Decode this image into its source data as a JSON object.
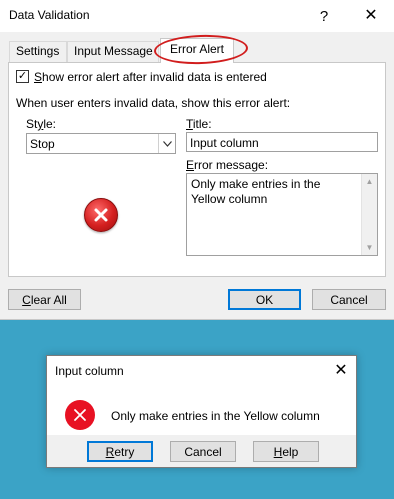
{
  "data_validation": {
    "title": "Data Validation",
    "help_glyph": "?",
    "close_glyph": "✕",
    "tabs": [
      {
        "label": "Settings"
      },
      {
        "label": "Input Message"
      },
      {
        "label": "Error Alert"
      }
    ],
    "active_tab": "Error Alert",
    "show_alert_checkbox": {
      "checked": true,
      "mark": "✓",
      "label_prefix": "",
      "accel": "S",
      "label_rest": "how error alert after invalid data is entered"
    },
    "instruction": "When user enters invalid data, show this error alert:",
    "style_label": {
      "prefix": "St",
      "accel": "y",
      "rest": "le:"
    },
    "style_value": "Stop",
    "title_label": {
      "accel": "T",
      "rest": "itle:"
    },
    "title_value": "Input column",
    "error_message_label": {
      "accel": "E",
      "rest": "rror message:"
    },
    "error_message_value": "Only make entries in the Yellow column",
    "icons": {
      "style_icon": "error-stop-icon",
      "dropdown": "chevron-down-icon"
    },
    "buttons": {
      "clear_all": {
        "accel": "C",
        "rest": "lear All"
      },
      "ok": "OK",
      "cancel": "Cancel"
    },
    "colors": {
      "highlight_circle": "#d11d1d",
      "focus_border": "#0078d7"
    }
  },
  "message_box": {
    "title": "Input column",
    "close_glyph": "✕",
    "message": "Only make entries in the Yellow column",
    "icon": "error-icon",
    "buttons": {
      "retry": {
        "accel": "R",
        "rest": "etry"
      },
      "cancel": "Cancel",
      "help": {
        "accel": "H",
        "rest": "elp"
      }
    },
    "colors": {
      "icon_red": "#e81123",
      "background": "#3ba3c6"
    }
  }
}
